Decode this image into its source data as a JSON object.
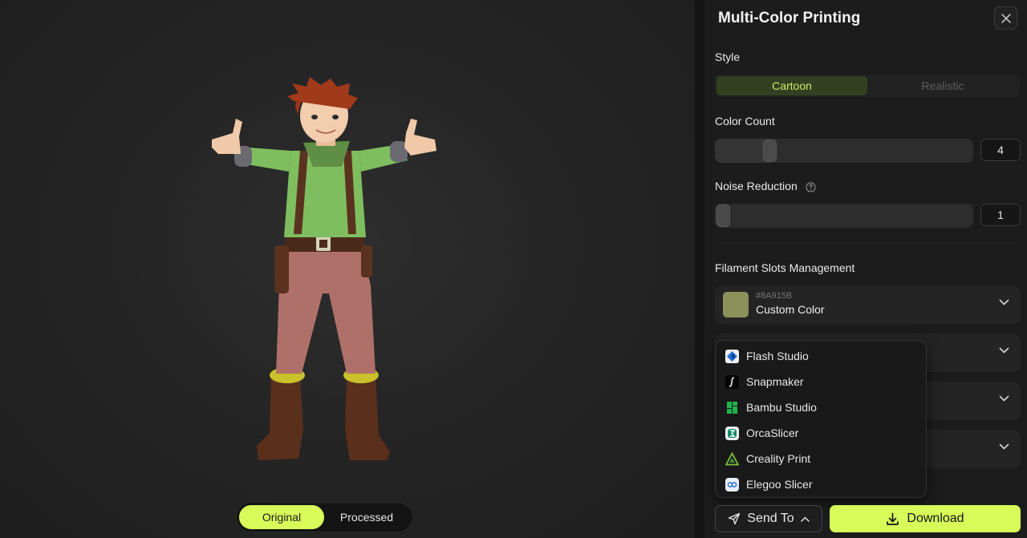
{
  "panel": {
    "title": "Multi-Color Printing",
    "close_icon": "close-icon"
  },
  "style": {
    "label": "Style",
    "options": [
      "Cartoon",
      "Realistic"
    ],
    "selected": "Cartoon"
  },
  "color_count": {
    "label": "Color Count",
    "value": "4",
    "level": 0.2
  },
  "noise_reduction": {
    "label": "Noise Reduction",
    "value": "1",
    "level": 0.0,
    "help_icon": "question-circle-icon"
  },
  "filament": {
    "label": "Filament Slots Management",
    "slots": [
      {
        "hex": "#8A915B",
        "name": "Custom Color",
        "color": "#8A915B"
      }
    ]
  },
  "send_menu": {
    "items": [
      {
        "label": "Flash Studio",
        "icon": "flash-studio-icon"
      },
      {
        "label": "Snapmaker",
        "icon": "snapmaker-icon"
      },
      {
        "label": "Bambu Studio",
        "icon": "bambu-studio-icon"
      },
      {
        "label": "OrcaSlicer",
        "icon": "orcaslicer-icon"
      },
      {
        "label": "Creality Print",
        "icon": "creality-print-icon"
      },
      {
        "label": "Elegoo Slicer",
        "icon": "elegoo-slicer-icon"
      }
    ]
  },
  "actions": {
    "send_to": "Send To",
    "download": "Download"
  },
  "view_toggle": {
    "options": [
      "Original",
      "Processed"
    ],
    "selected": "Original"
  },
  "colors": {
    "accent": "#D8FB5A",
    "cartoon_active_text": "#CDEA66"
  }
}
